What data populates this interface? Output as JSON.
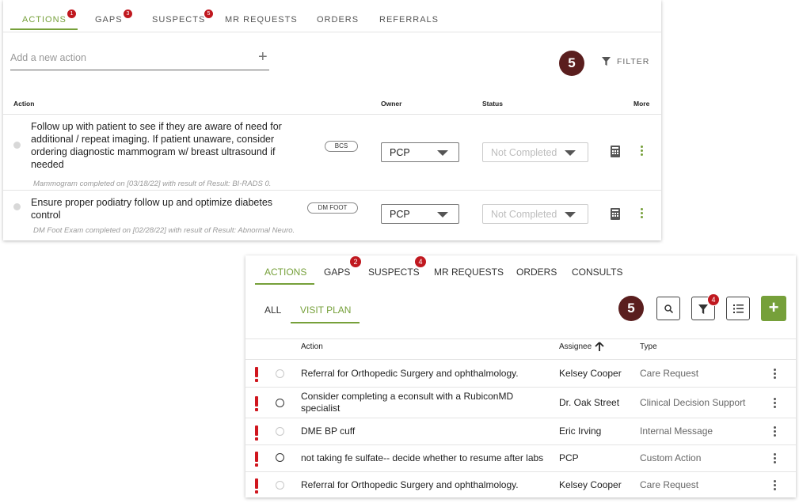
{
  "panel1": {
    "tabs": [
      {
        "label": "ACTIONS",
        "badge": "1",
        "active": true
      },
      {
        "label": "GAPS",
        "badge": "3",
        "active": false
      },
      {
        "label": "SUSPECTS",
        "badge": "5",
        "active": false
      },
      {
        "label": "MR REQUESTS",
        "badge": "",
        "active": false
      },
      {
        "label": "ORDERS",
        "badge": "",
        "active": false
      },
      {
        "label": "REFERRALS",
        "badge": "",
        "active": false
      }
    ],
    "add_placeholder": "Add a new action",
    "callout": "5",
    "filter_label": "FILTER",
    "columns": {
      "action": "Action",
      "owner": "Owner",
      "status": "Status",
      "more": "More"
    },
    "rows": [
      {
        "text": "Follow up with patient to see if they are aware of need for additional / repeat imaging. If patient unaware, consider ordering diagnostic mammogram w/ breast ultrasound if needed",
        "sub": "Mammogram completed on [03/18/22] with result of Result: BI-RADS 0.",
        "tag": "BCS",
        "owner": "PCP",
        "status": "Not Completed"
      },
      {
        "text": "Ensure proper podiatry follow up and optimize diabetes control",
        "sub": "DM Foot Exam completed on [02/28/22] with result of Result: Abnormal Neuro.",
        "tag": "DM FOOT",
        "owner": "PCP",
        "status": "Not Completed"
      }
    ]
  },
  "panel2": {
    "tabs": [
      {
        "label": "ACTIONS",
        "badge": "",
        "active": true
      },
      {
        "label": "GAPS",
        "badge": "2",
        "active": false
      },
      {
        "label": "SUSPECTS",
        "badge": "4",
        "active": false
      },
      {
        "label": "MR REQUESTS",
        "badge": "",
        "active": false
      },
      {
        "label": "ORDERS",
        "badge": "",
        "active": false
      },
      {
        "label": "CONSULTS",
        "badge": "",
        "active": false
      }
    ],
    "subtabs": [
      {
        "label": "ALL",
        "active": false
      },
      {
        "label": "VISIT PLAN",
        "active": true
      }
    ],
    "callout": "5",
    "filter_badge": "4",
    "add_label": "+",
    "columns": {
      "action": "Action",
      "assignee": "Assignee",
      "type": "Type"
    },
    "rows": [
      {
        "action": "Referral for Orthopedic Surgery and ophthalmology.",
        "assignee": "Kelsey Cooper",
        "type": "Care Request",
        "radio": "light"
      },
      {
        "action": "Consider completing a econsult with a RubiconMD specialist",
        "assignee": "Dr. Oak Street",
        "type": "Clinical Decision Support",
        "radio": "dark"
      },
      {
        "action": "DME BP cuff",
        "assignee": "Eric Irving",
        "type": "Internal Message",
        "radio": "light"
      },
      {
        "action": "not taking fe sulfate-- decide whether to resume after labs",
        "assignee": "PCP",
        "type": "Custom Action",
        "radio": "dark"
      },
      {
        "action": "Referral for Orthopedic Surgery and ophthalmology.",
        "assignee": "Kelsey Cooper",
        "type": "Care Request",
        "radio": "light"
      }
    ]
  },
  "colors": {
    "accent": "#76a03a",
    "badge": "#c0181f",
    "callout": "#5a1e1e",
    "priority": "#d0161e"
  }
}
